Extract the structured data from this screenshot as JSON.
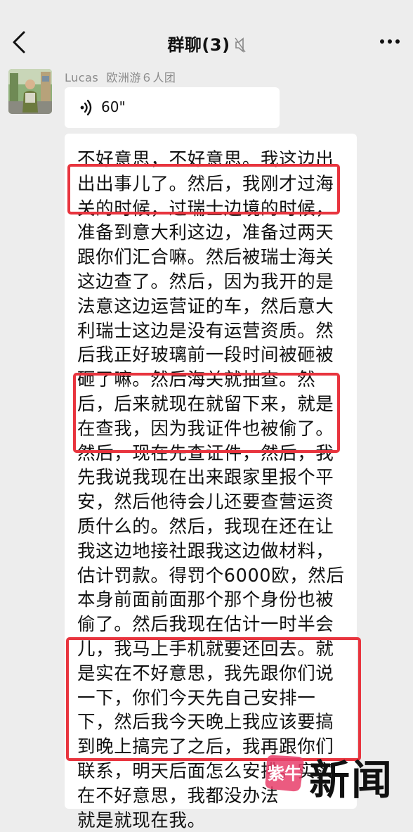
{
  "header": {
    "title": "群聊(3)",
    "back_icon": "back-chevron-icon",
    "mute_icon": "muted-speaker-icon",
    "more_icon": "more-dots-icon"
  },
  "message": {
    "sender_name": "Lucas",
    "sender_group": "欧洲游６人团",
    "voice": {
      "icon": "voice-wave-icon",
      "duration": "60\""
    },
    "transcript_lines": [
      "不好意思，不好意思。我这边出",
      "出出事儿了。然后，我刚才过海",
      "关的时候，过瑞士边境的时候，",
      "准备到意大利这边，准备过两天",
      "跟你们汇合嘛。然后被瑞士海关",
      "这边查了。然后，因为我开的是",
      "法意这边运营证的车，然后意大",
      "利瑞士这边是没有运营资质。然",
      "后我正好玻璃前一段时间被砸被",
      "砸了嘛。然后海关就抽查。然",
      "后，后来就现在就留下来，就是",
      "在查我，因为我证件也被偷了。",
      "然后，现在先查证件，然后，我",
      "先我说我现在出来跟家里报个平",
      "安，然后他待会儿还要查营运资",
      "质什么的。然后，我现在还在让",
      "我这边地接社跟我这边做材料，",
      "估计罚款。得罚个6000欧，然后",
      "本身前面前面那个那个身份也被",
      "偷了。然后我现在估计一时半会",
      "儿，我马上手机就要还回去。就",
      "是实在不好意思，我先跟你们说",
      "一下，你们今天先自己安排一",
      "下，然后我今天晚上我应该要搞",
      "到晚上搞完了之后，我再跟你们",
      "联系，明天后面怎么安排。实实",
      "在不好意思，我都没办法",
      "就是就现在我。"
    ]
  },
  "watermark": {
    "badge_text": "紫牛",
    "text": "新闻"
  },
  "colors": {
    "highlight_border": "#e8343e",
    "background": "#ededed",
    "bubble": "#ffffff"
  }
}
